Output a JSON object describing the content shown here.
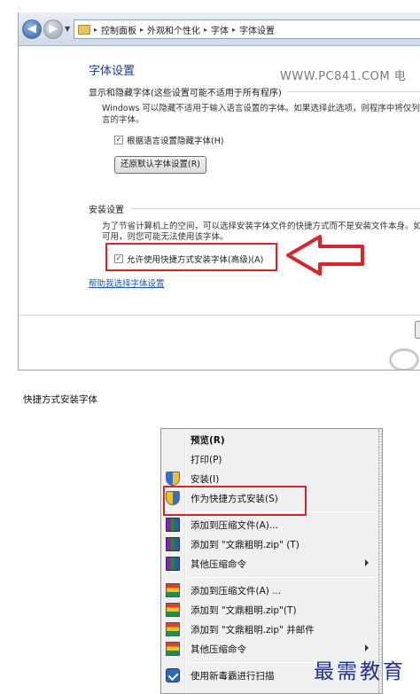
{
  "window": {
    "breadcrumb": [
      "控制面板",
      "外观和个性化",
      "字体",
      "字体设置"
    ],
    "title": "字体设置",
    "watermark": "WWW.PC841.COM 电",
    "show_hide": {
      "heading": "显示和隐藏字体(这些设置可能不适用于所有程序)",
      "desc_line1": "Windows 可以隐藏不适用于输入语言设置的字体。如果选择此选项，则程序中将仅列出适",
      "desc_line2": "言的字体。",
      "checkbox_label": "根据语言设置隐藏字体(H)",
      "checkbox_checked": true,
      "restore_button": "还原默认字体设置(R)"
    },
    "install": {
      "heading": "安装设置",
      "desc_line1": "为了节省计算机上的空间，可以选择安装字体文件的快捷方式而不是安装文件本身。如果该",
      "desc_line2": "可用，则您可能无法使用该字体。",
      "checkbox_label": "允许使用快捷方式安装字体(高级)(A)",
      "checkbox_checked": true
    },
    "help_link": "帮助我选择字体设置"
  },
  "caption": "快捷方式安装字体",
  "context_menu": {
    "items": [
      {
        "label": "预览(R)",
        "icon": "none",
        "bold": true,
        "submenu": false
      },
      {
        "label": "打印(P)",
        "icon": "none",
        "bold": false,
        "submenu": false
      },
      {
        "label": "安装(I)",
        "icon": "uac-shield-icon",
        "bold": false,
        "submenu": false
      },
      {
        "label": "作为快捷方式安装(S)",
        "icon": "uac-shield-icon",
        "bold": false,
        "submenu": false
      },
      {
        "label": "添加到压缩文件(A)...",
        "icon": "winrar-icon",
        "bold": false,
        "submenu": false
      },
      {
        "label": "添加到 \"文鼎粗明.zip\" (T)",
        "icon": "winrar-icon",
        "bold": false,
        "submenu": false
      },
      {
        "label": "其他压缩命令",
        "icon": "winrar-icon",
        "bold": false,
        "submenu": true
      },
      {
        "label": "添加到压缩文件(A) ...",
        "icon": "zip-archiver-icon",
        "bold": false,
        "submenu": false
      },
      {
        "label": "添加到 \"文鼎粗明.zip\"(T)",
        "icon": "zip-archiver-icon",
        "bold": false,
        "submenu": false
      },
      {
        "label": "添加到 \"文鼎粗明.zip\" 并邮件",
        "icon": "zip-archiver-icon",
        "bold": false,
        "submenu": false
      },
      {
        "label": "其他压缩命令",
        "icon": "zip-archiver-icon",
        "bold": false,
        "submenu": true
      },
      {
        "label": "使用新毒霸进行扫描",
        "icon": "antivirus-scan-icon",
        "bold": false,
        "submenu": false
      }
    ]
  },
  "stamp": "最需教育",
  "colors": {
    "highlight_red": "#d8252b",
    "link_blue": "#1a56b5",
    "title_blue": "#1e3a8a"
  }
}
